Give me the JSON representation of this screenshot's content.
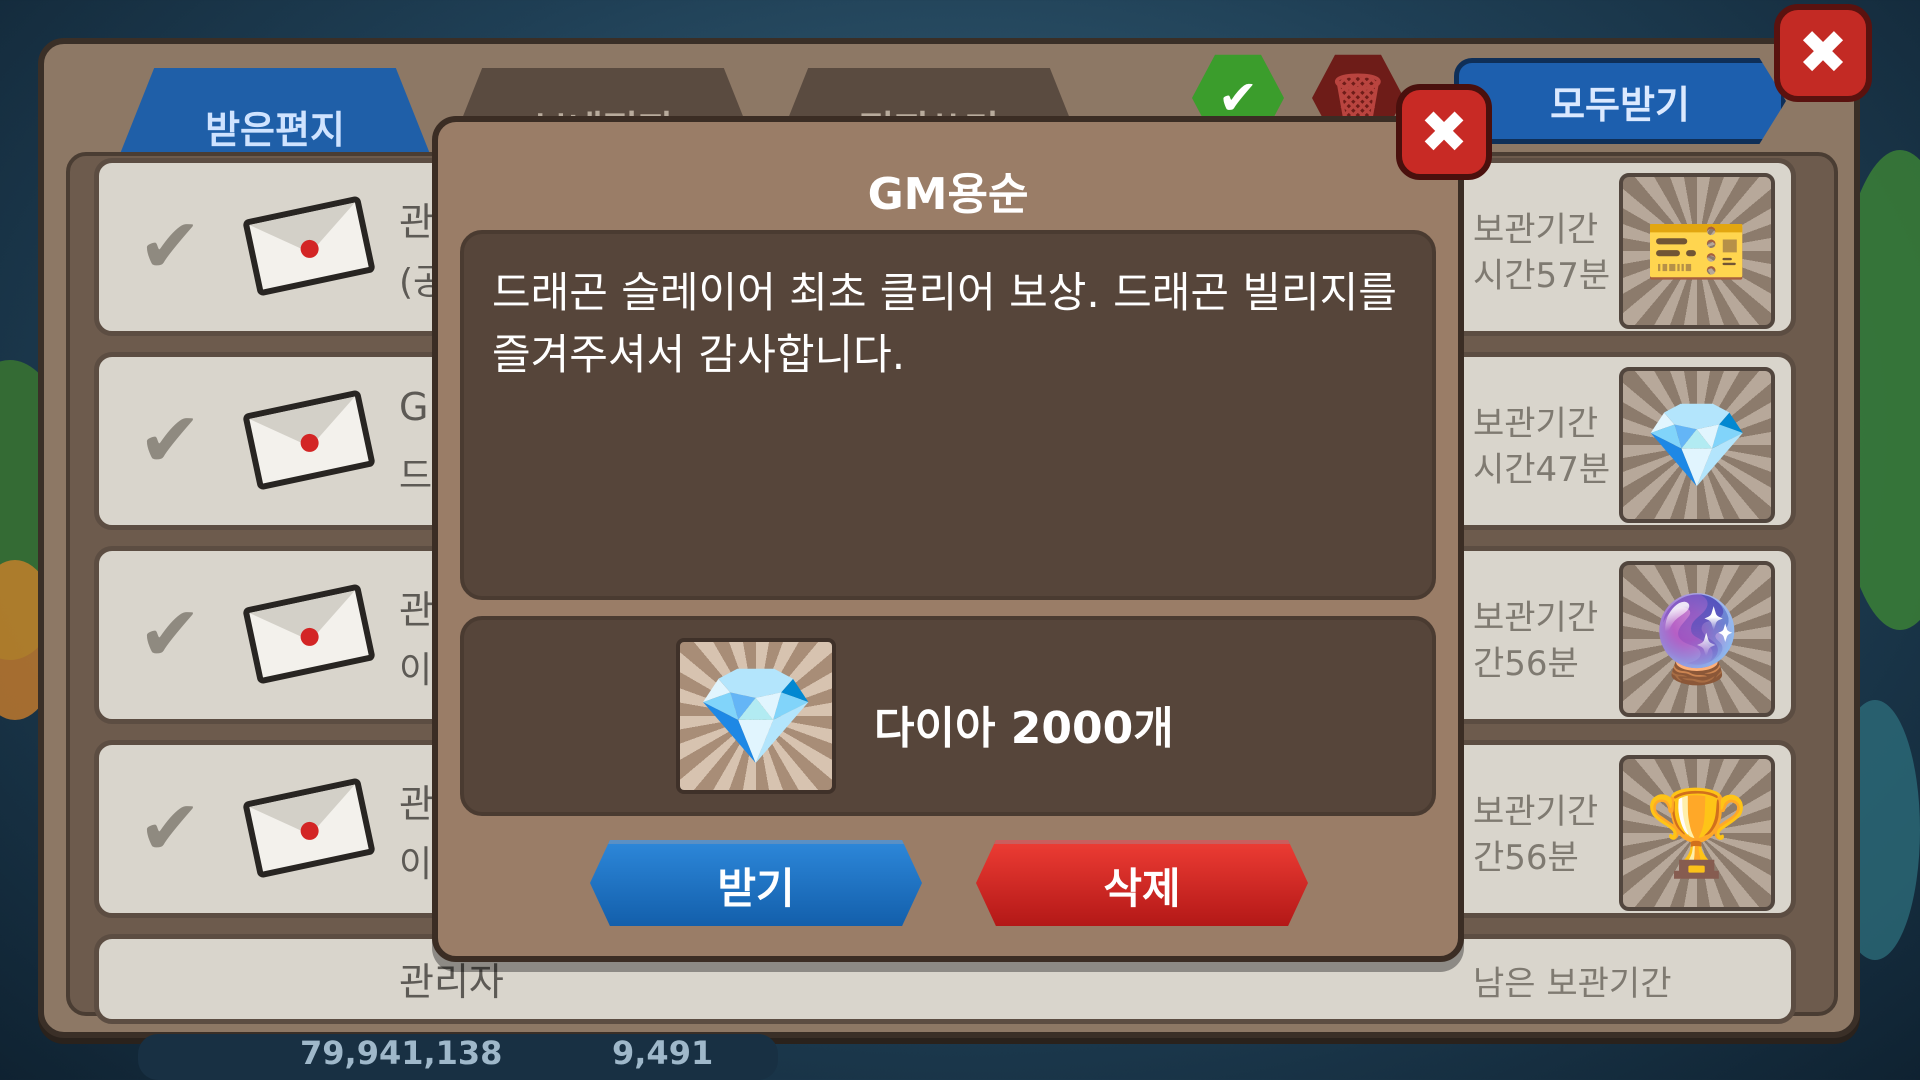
{
  "mailbox": {
    "tabs": [
      {
        "label": "받은편지"
      },
      {
        "label": "보내편지"
      },
      {
        "label": "편지쓰기"
      }
    ],
    "receive_all_label": "모두받기",
    "rows": [
      {
        "sender": "관",
        "subtitle": "(공",
        "time": "보관기간\n시간57분",
        "reward_icon": "ticket-icon"
      },
      {
        "sender": "G",
        "subtitle": "드",
        "time": "보관기간\n시간47분",
        "reward_icon": "diamond-icon"
      },
      {
        "sender": "관",
        "subtitle": "이",
        "time": "보관기간\n간56분",
        "reward_icon": "dark-gem-icon"
      },
      {
        "sender": "관",
        "subtitle": "이",
        "time": "보관기간\n간56분",
        "reward_icon": "trophy-rp-icon"
      },
      {
        "sender": "관리자",
        "subtitle": "",
        "time": "남은 보관기간",
        "reward_icon": "diamond-icon"
      }
    ]
  },
  "currency": {
    "gold": "79,941,138",
    "diamonds": "9,491"
  },
  "dialog": {
    "title": "GM용순",
    "message": "드래곤 슬레이어 최초 클리어 보상. 드래곤 빌리지를 즐겨주셔서 감사합니다.",
    "reward_label": "다이아 2000개",
    "receive_label": "받기",
    "delete_label": "삭제"
  },
  "colors": {
    "accent_blue": "#1f5fa8",
    "accent_red": "#c82a25",
    "panel_brown": "#9a7d67"
  }
}
